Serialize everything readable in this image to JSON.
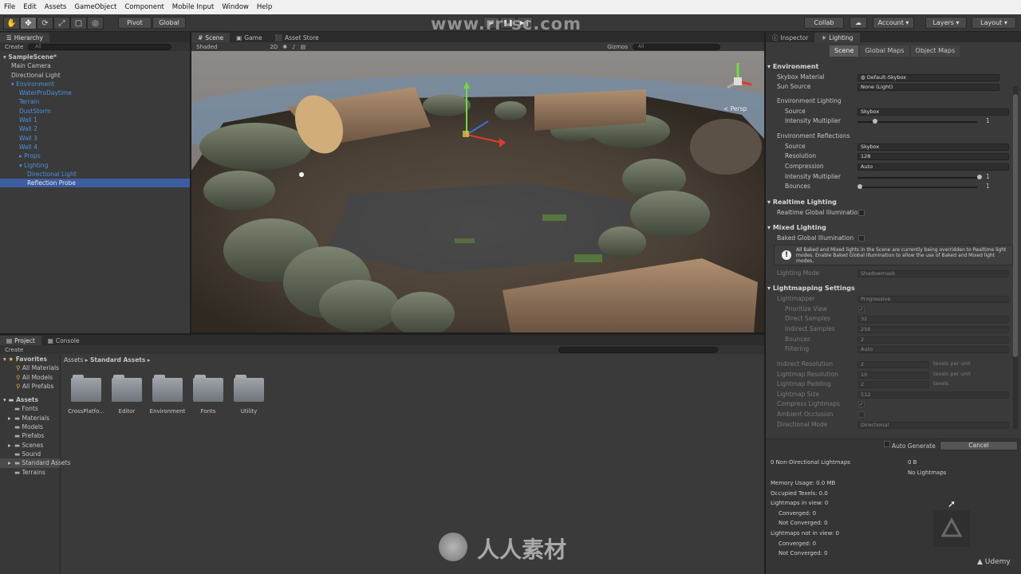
{
  "menu": [
    "File",
    "Edit",
    "Assets",
    "GameObject",
    "Component",
    "Mobile Input",
    "Window",
    "Help"
  ],
  "toolbar": {
    "pivot": "Pivot",
    "global": "Global",
    "collab": "Collab",
    "account": "Account",
    "layers": "Layers",
    "layout": "Layout",
    "watermark_url": "www.rr-sc.com"
  },
  "hierarchy": {
    "tab": "Hierarchy",
    "create": "Create",
    "search_placeholder": "All",
    "items": [
      {
        "label": "SampleScene*",
        "indent": 0
      },
      {
        "label": "Main Camera",
        "indent": 1
      },
      {
        "label": "Directional Light",
        "indent": 1
      },
      {
        "label": "Environment",
        "indent": 1
      },
      {
        "label": "WaterProDaytime",
        "indent": 2
      },
      {
        "label": "Terrain",
        "indent": 2
      },
      {
        "label": "DustStorm",
        "indent": 2
      },
      {
        "label": "Wall 1",
        "indent": 2
      },
      {
        "label": "Wall 2",
        "indent": 2
      },
      {
        "label": "Wall 3",
        "indent": 2
      },
      {
        "label": "Wall 4",
        "indent": 2
      },
      {
        "label": "Props",
        "indent": 2
      },
      {
        "label": "Lighting",
        "indent": 2
      },
      {
        "label": "Directional Light",
        "indent": 3
      },
      {
        "label": "Reflection Probe",
        "indent": 3
      }
    ]
  },
  "scene": {
    "tabs": [
      "Scene",
      "Game",
      "Asset Store"
    ],
    "shading": "Shaded",
    "mode_2d": "2D",
    "gizmos": "Gizmos",
    "search_placeholder": "All",
    "persp": "Persp"
  },
  "project": {
    "tabs": [
      "Project",
      "Console"
    ],
    "create": "Create",
    "favorites_label": "Favorites",
    "favorites": [
      "All Materials",
      "All Models",
      "All Prefabs"
    ],
    "assets_label": "Assets",
    "asset_folders": [
      "Fonts",
      "Materials",
      "Models",
      "Prefabs",
      "Scenes",
      "Sound",
      "Standard Assets",
      "Terrains"
    ],
    "breadcrumb_root": "Assets",
    "breadcrumb_current": "Standard Assets",
    "grid_folders": [
      "CrossPlatfo...",
      "Editor",
      "Environment",
      "Fonts",
      "Utility"
    ]
  },
  "inspector": {
    "tabs": [
      "Inspector",
      "Lighting"
    ],
    "subtabs": [
      "Scene",
      "Global Maps",
      "Object Maps"
    ],
    "environment": {
      "title": "Environment",
      "skybox_label": "Skybox Material",
      "skybox_value": "Default-Skybox",
      "sun_label": "Sun Source",
      "sun_value": "None (Light)",
      "lighting_header": "Environment Lighting",
      "source_label": "Source",
      "source_value": "Skybox",
      "intensity_label": "Intensity Multiplier",
      "intensity_value": "1",
      "reflections_header": "Environment Reflections",
      "ref_source_label": "Source",
      "ref_source_value": "Skybox",
      "resolution_label": "Resolution",
      "resolution_value": "128",
      "compression_label": "Compression",
      "compression_value": "Auto",
      "ref_intensity_label": "Intensity Multiplier",
      "ref_intensity_value": "1",
      "bounces_label": "Bounces",
      "bounces_value": "1"
    },
    "realtime": {
      "title": "Realtime Lighting",
      "gi_label": "Realtime Global Illuminatio"
    },
    "mixed": {
      "title": "Mixed Lighting",
      "baked_label": "Baked Global Illumination",
      "warning": "All Baked and Mixed lights in the Scene are currently being overridden to Realtime light modes. Enable Baked Global Illumination to allow the use of Baked and Mixed light modes.",
      "mode_label": "Lighting Mode",
      "mode_value": "Shadowmask"
    },
    "lightmapping": {
      "title": "Lightmapping Settings",
      "rows": [
        {
          "label": "Lightmapper",
          "value": "Progressive",
          "kind": "dropdown"
        },
        {
          "label": "Prioritize View",
          "value": "✓",
          "kind": "check"
        },
        {
          "label": "Direct Samples",
          "value": "32",
          "kind": "text"
        },
        {
          "label": "Indirect Samples",
          "value": "256",
          "kind": "text"
        },
        {
          "label": "Bounces",
          "value": "2",
          "kind": "dropdown"
        },
        {
          "label": "Filtering",
          "value": "Auto",
          "kind": "dropdown"
        },
        {
          "label": "Indirect Resolution",
          "value": "2",
          "kind": "text",
          "unit": "texels per unit"
        },
        {
          "label": "Lightmap Resolution",
          "value": "10",
          "kind": "text",
          "unit": "texels per unit"
        },
        {
          "label": "Lightmap Padding",
          "value": "2",
          "kind": "text",
          "unit": "texels"
        },
        {
          "label": "Lightmap Size",
          "value": "512",
          "kind": "dropdown"
        },
        {
          "label": "Compress Lightmaps",
          "value": "✓",
          "kind": "check"
        },
        {
          "label": "Ambient Occlusion",
          "value": "",
          "kind": "check"
        },
        {
          "label": "Directional Mode",
          "value": "Directional",
          "kind": "dropdown"
        }
      ]
    },
    "auto_generate": "Auto Generate",
    "cancel": "Cancel",
    "stats": {
      "non_directional": "0 Non-Directional Lightmaps",
      "size": "0 B",
      "no_lightmaps": "No Lightmaps",
      "memory": "Memory Usage: 0.0 MB",
      "texels": "Occupied Texels: 0.0",
      "in_view": "Lightmaps in view: 0",
      "converged1": "Converged: 0",
      "not_converged1": "Not Converged: 0",
      "not_in_view": "Lightmaps not in view: 0",
      "converged2": "Converged: 0",
      "not_converged2": "Not Converged: 0"
    }
  },
  "brand": {
    "udemy": "Udemy",
    "site_cn": "人人素材"
  },
  "colors": {
    "accent": "#3c5d9f",
    "link": "#4d92e0"
  }
}
